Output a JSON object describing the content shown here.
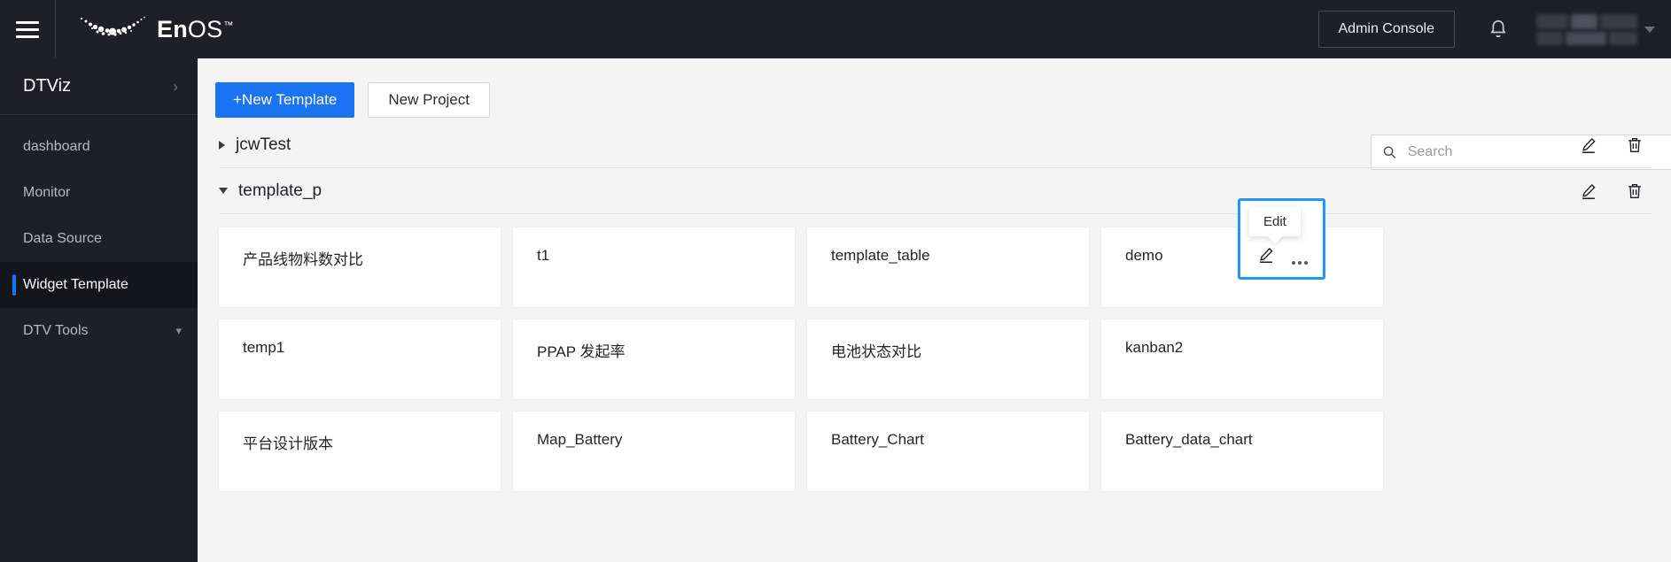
{
  "topbar": {
    "menu_icon": "hamburger-icon",
    "brand_bold": "En",
    "brand_light": "OS",
    "brand_tm": "™",
    "admin_console_label": "Admin Console",
    "bell_icon": "bell-icon",
    "user_caret_icon": "chevron-down-icon"
  },
  "sidebar": {
    "title": "DTViz",
    "title_chevron": "chevron-right-icon",
    "items": [
      {
        "label": "dashboard",
        "active": false,
        "chevron": ""
      },
      {
        "label": "Monitor",
        "active": false,
        "chevron": ""
      },
      {
        "label": "Data Source",
        "active": false,
        "chevron": ""
      },
      {
        "label": "Widget Template",
        "active": true,
        "chevron": ""
      },
      {
        "label": "DTV Tools",
        "active": false,
        "chevron": "chevron-down-icon"
      }
    ],
    "accent_color": "#1a73f0",
    "background_color": "#1f1f29"
  },
  "toolbar": {
    "new_template_label": "+New Template",
    "new_project_label": "New Project",
    "primary_color": "#1a73f0"
  },
  "search": {
    "placeholder": "Search",
    "value": "",
    "icon": "search-icon"
  },
  "groups": [
    {
      "name": "jcwTest",
      "expanded": false,
      "toggle_icon": "triangle-right-icon",
      "edit_icon": "pencil-icon",
      "delete_icon": "trash-icon",
      "cards": []
    },
    {
      "name": "template_p",
      "expanded": true,
      "toggle_icon": "triangle-down-icon",
      "edit_icon": "pencil-icon",
      "delete_icon": "trash-icon",
      "cards": [
        "产品线物料数对比",
        "t1",
        "template_table",
        "demo",
        "temp1",
        "PPAP 发起率",
        "电池状态对比",
        "kanban2",
        "平台设计版本",
        "Map_Battery",
        "Battery_Chart",
        "Battery_data_chart"
      ]
    }
  ],
  "popover": {
    "tooltip_label": "Edit",
    "edit_icon": "pencil-icon",
    "more_icon": "ellipsis-icon",
    "highlight_color": "#2196f3"
  }
}
